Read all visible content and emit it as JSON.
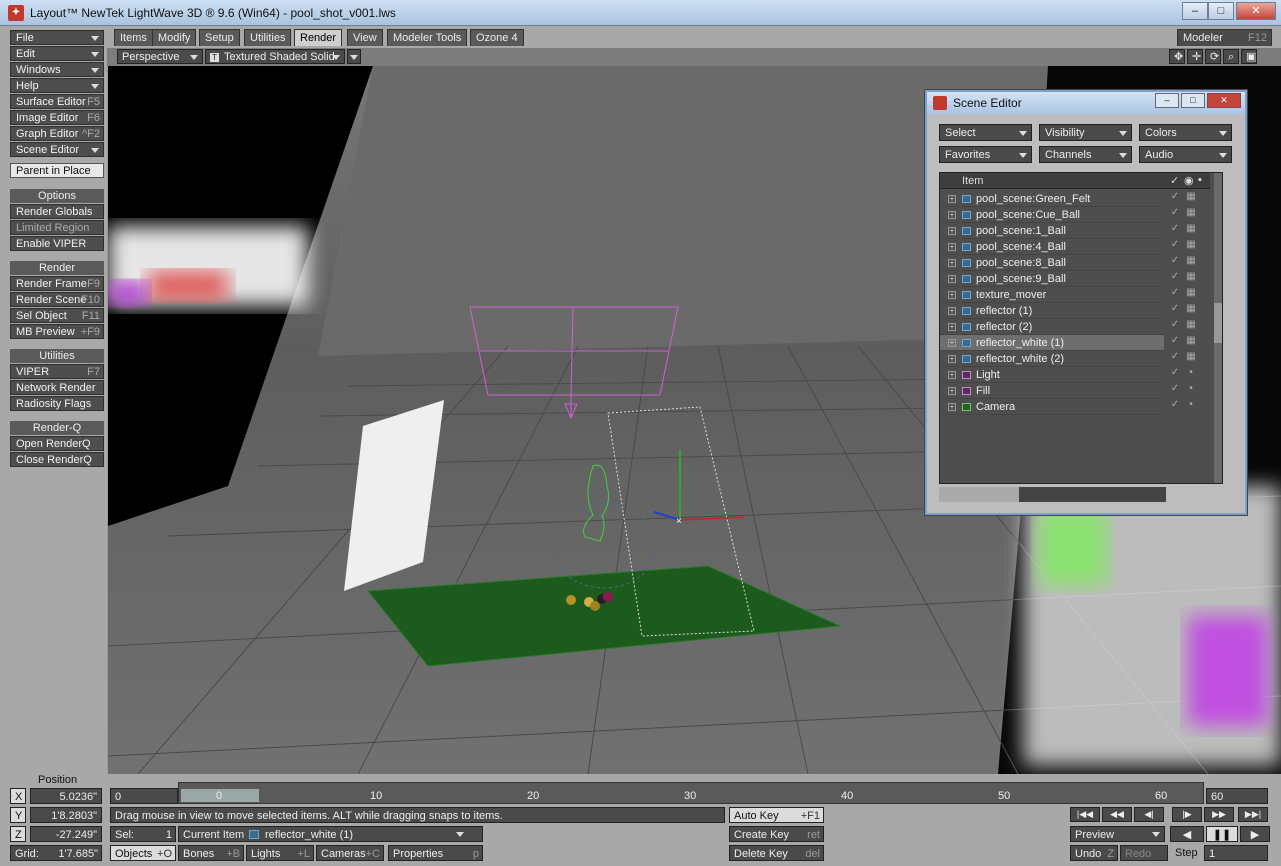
{
  "window": {
    "title": "Layout™ NewTek LightWave 3D ® 9.6  (Win64) - pool_shot_v001.lws",
    "min": "–",
    "max": "□",
    "close": "✕"
  },
  "menus": [
    {
      "label": "File",
      "sc": ""
    },
    {
      "label": "Edit",
      "sc": ""
    },
    {
      "label": "Windows",
      "sc": ""
    },
    {
      "label": "Help",
      "sc": ""
    },
    {
      "label": "Surface Editor",
      "sc": "F5"
    },
    {
      "label": "Image Editor",
      "sc": "F6"
    },
    {
      "label": "Graph Editor",
      "sc": "^F2"
    },
    {
      "label": "Scene Editor",
      "sc": ""
    }
  ],
  "parent_in_place": "Parent in Place",
  "options": {
    "title": "Options",
    "items": [
      "Render Globals",
      "Limited Region",
      "Enable VIPER"
    ]
  },
  "render": {
    "title": "Render",
    "items": [
      {
        "label": "Render Frame",
        "sc": "F9"
      },
      {
        "label": "Render Scene",
        "sc": "F10"
      },
      {
        "label": "Sel Object",
        "sc": "F11"
      },
      {
        "label": "MB Preview",
        "sc": "+F9"
      }
    ]
  },
  "utilities": {
    "title": "Utilities",
    "items": [
      {
        "label": "VIPER",
        "sc": "F7"
      },
      {
        "label": "Network Render",
        "sc": ""
      },
      {
        "label": "Radiosity Flags",
        "sc": ""
      }
    ]
  },
  "renderq": {
    "title": "Render-Q",
    "items": [
      "Open RenderQ",
      "Close RenderQ"
    ]
  },
  "tabs": [
    "Items",
    "Modify",
    "Setup",
    "Utilities",
    "Render",
    "View",
    "Modeler Tools",
    "Ozone 4"
  ],
  "active_tab": "Render",
  "modeler": {
    "label": "Modeler",
    "sc": "F12"
  },
  "viewport": {
    "view": "Perspective",
    "mode": "Textured Shaded Solid",
    "mode_icon": "T"
  },
  "scene_editor": {
    "title": "Scene Editor",
    "drops": [
      "Select",
      "Visibility",
      "Colors",
      "Favorites",
      "Channels",
      "Audio"
    ],
    "column": "Item",
    "items": [
      {
        "label": "pool_scene:Green_Felt",
        "type": "obj"
      },
      {
        "label": "pool_scene:Cue_Ball",
        "type": "obj"
      },
      {
        "label": "pool_scene:1_Ball",
        "type": "obj"
      },
      {
        "label": "pool_scene:4_Ball",
        "type": "obj"
      },
      {
        "label": "pool_scene:8_Ball",
        "type": "obj"
      },
      {
        "label": "pool_scene:9_Ball",
        "type": "obj"
      },
      {
        "label": "texture_mover",
        "type": "obj"
      },
      {
        "label": "reflector (1)",
        "type": "obj"
      },
      {
        "label": "reflector (2)",
        "type": "obj"
      },
      {
        "label": "reflector_white (1)",
        "type": "obj",
        "selected": true
      },
      {
        "label": "reflector_white (2)",
        "type": "obj"
      },
      {
        "label": "Light",
        "type": "light"
      },
      {
        "label": "Fill",
        "type": "light"
      },
      {
        "label": "Camera",
        "type": "cam"
      }
    ]
  },
  "position": {
    "label": "Position",
    "x_label": "X",
    "x": "5.0236\"",
    "y_label": "Y",
    "y": "1'8.2803\"",
    "z_label": "Z",
    "z": "-27.249\"",
    "grid_label": "Grid:",
    "grid": "1'7.685\""
  },
  "timeline": {
    "start": "0",
    "end": "60",
    "current": "0",
    "ticks": [
      "10",
      "20",
      "30",
      "40",
      "50",
      "60"
    ]
  },
  "status": "Drag mouse in view to move selected items. ALT while dragging snaps to items.",
  "sel": {
    "label": "Sel:",
    "value": "1"
  },
  "current_item": {
    "label": "Current Item",
    "value": "reflector_white (1)"
  },
  "modes": [
    {
      "label": "Objects",
      "sc": "+O"
    },
    {
      "label": "Bones",
      "sc": "+B"
    },
    {
      "label": "Lights",
      "sc": "+L"
    },
    {
      "label": "Cameras",
      "sc": "+C"
    },
    {
      "label": "Properties",
      "sc": "p"
    }
  ],
  "keys": [
    {
      "label": "Auto Key",
      "sc": "+F1"
    },
    {
      "label": "Create Key",
      "sc": "ret"
    },
    {
      "label": "Delete Key",
      "sc": "del"
    }
  ],
  "preview": "Preview",
  "undo": {
    "label": "Undo",
    "sc": "Z"
  },
  "redo": "Redo",
  "step": {
    "label": "Step",
    "value": "1"
  }
}
